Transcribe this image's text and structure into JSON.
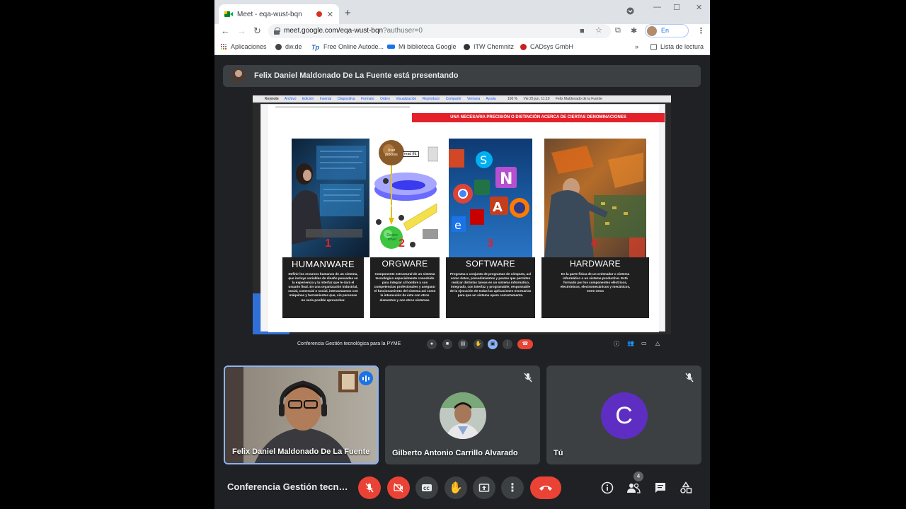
{
  "browser": {
    "tab_title": "Meet - eqa-wust-bqn",
    "url_host": "meet.google.com/eqa-wust-bqn",
    "url_query": "?authuser=0",
    "profile_status": "En pausa",
    "bookmarks": [
      "Aplicaciones",
      "dw.de",
      "Free Online Autode...",
      "Mi biblioteca Google",
      "ITW Chemnitz",
      "CADsys GmbH"
    ],
    "reading_list": "Lista de lectura",
    "overflow": "»"
  },
  "meet": {
    "presenter_banner": "Felix Daniel Maldonado De La Fuente está presentando",
    "meeting_title": "Conferencia Gestión tecnol...",
    "participants_count": "4",
    "tiles": [
      {
        "name": "Felix Daniel Maldonado De La Fuente"
      },
      {
        "name": "Gilberto Antonio Carrillo Alvarado"
      },
      {
        "name": "Tú",
        "initial": "C"
      }
    ]
  },
  "shared_screen": {
    "mac_menu": [
      "Keynote",
      "Archivo",
      "Edición",
      "Insertar",
      "Diapositiva",
      "Formato",
      "Orden",
      "Visualización",
      "Reproducir",
      "Compartir",
      "Ventana",
      "Ayuda",
      "100 %",
      "Vie 25 jun. 11:10",
      "Felix Maldonado de la Fuente"
    ],
    "inner_meeting_title": "Conferencia Gestión tecnológica para la PYME",
    "slide": {
      "banner": "UNA NECESARIA PRECISIÓN O DISTINCIÓN ACERCA DE CIERTAS DENOMINACIONES",
      "cards": [
        {
          "number": "1",
          "title": "HUMANWARE",
          "text": "Definir los recursos humanos de un sistema, que incluye variables de diseño pensadas en la experiencia y la interfaz que le dará el usuario final. En una organización industrial, social, comercial o social, interactuamos con máquinas y herramientas que, sin personas no sería posible aprovechar."
        },
        {
          "number": "2",
          "title": "ORGWARE",
          "text": "Componente estructural de un sistema tecnológico especialmente concebido para integrar al hombre y sus competencias profesionales y asegurar el funcionamiento del sistema así como la interacción de éste con otros elementos y con otros sistemas."
        },
        {
          "number": "3",
          "title": "SOFTWARE",
          "text": "Programa o conjunto de programas de cómputo, así como datos, procedimientos y pautas que permiten realizar distintas tareas en un sistema informático, integrado, con interfaz y programable; responsable de la ejecución de todas las aplicaciones necesarias para que un sistema opere correctamente."
        },
        {
          "number": "4",
          "title": "HARDWARE",
          "text": "Es la parte física de un ordenador o sistema informático o un sistema productivo. Está formado por los componentes eléctricos, electrónicos, electromecánicos y mecánicos, entre otros"
        }
      ],
      "diagram_labels": [
        "User process",
        "read (fd,",
        "Kernel",
        "Device driver"
      ]
    }
  }
}
